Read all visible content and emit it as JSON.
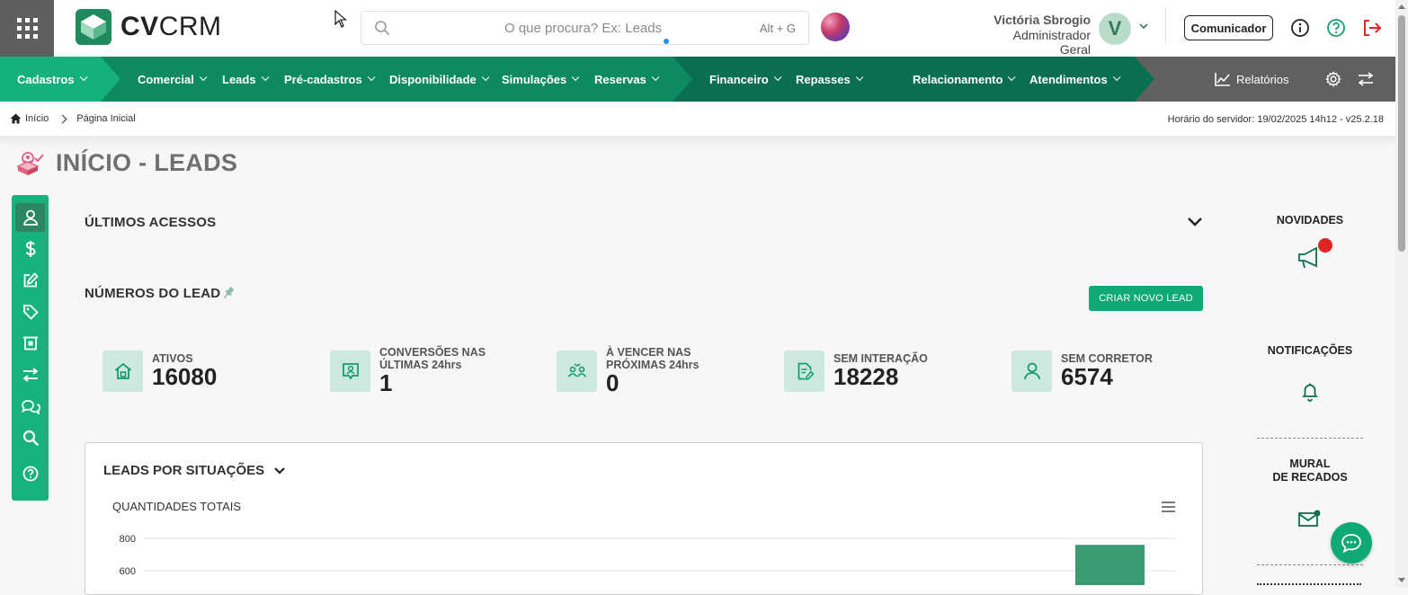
{
  "header": {
    "logo_bold": "CV",
    "logo_light": "CRM",
    "search_placeholder": "O que procura? Ex: Leads",
    "search_shortcut": "Alt + G",
    "user_name": "Victória Sbrogio",
    "user_role": "Administrador Geral",
    "avatar_initial": "V",
    "comunicador_label": "Comunicador"
  },
  "nav": {
    "items": [
      {
        "label": "Cadastros"
      },
      {
        "label": "Comercial"
      },
      {
        "label": "Leads"
      },
      {
        "label": "Pré-cadastros"
      },
      {
        "label": "Disponibilidade"
      },
      {
        "label": "Simulações"
      },
      {
        "label": "Reservas"
      },
      {
        "label": "Financeiro"
      },
      {
        "label": "Repasses"
      },
      {
        "label": "Relacionamento"
      },
      {
        "label": "Atendimentos"
      },
      {
        "label": "Relatórios"
      }
    ],
    "colors": {
      "dark": "#0a6e50",
      "mid": "#0e8a63",
      "light": "#15b07e",
      "gray": "#606060"
    }
  },
  "breadcrumb": {
    "home": "Início",
    "current": "Página Inicial",
    "server_time": "Horário do servidor: 19/02/2025 14h12 - v25.2.18"
  },
  "page": {
    "title": "INÍCIO - LEADS"
  },
  "main": {
    "ultimos_acessos": "ÚLTIMOS ACESSOS",
    "numeros_lead": "NÚMEROS DO LEAD",
    "new_lead_button": "CRIAR NOVO LEAD",
    "stats": [
      {
        "label1": "ATIVOS",
        "label2": "",
        "value": "16080",
        "icon": "home-icon"
      },
      {
        "label1": "CONVERSÕES NAS",
        "label2": "ÚLTIMAS 24hrs",
        "value": "1",
        "icon": "user-badge-icon"
      },
      {
        "label1": "À VENCER NAS",
        "label2": "PRÓXIMAS 24hrs",
        "value": "0",
        "icon": "users-clock-icon"
      },
      {
        "label1": "SEM INTERAÇÃO",
        "label2": "",
        "value": "18228",
        "icon": "document-edit-icon"
      },
      {
        "label1": "SEM CORRETOR",
        "label2": "",
        "value": "6574",
        "icon": "user-icon"
      }
    ],
    "card_title": "LEADS POR SITUAÇÕES",
    "card_subtitle": "QUANTIDADES TOTAIS"
  },
  "chart_data": {
    "type": "bar",
    "title": "QUANTIDADES TOTAIS",
    "y_ticks": [
      "800",
      "600"
    ],
    "ylim": [
      0,
      900
    ],
    "visible_bar_value": 760,
    "bar_color": "#3a9a72"
  },
  "right_panel": {
    "novidades": "NOVIDADES",
    "notificacoes": "NOTIFICAÇÕES",
    "mural_line1": "MURAL",
    "mural_line2": "DE RECADOS",
    "accent": "#e02424"
  }
}
